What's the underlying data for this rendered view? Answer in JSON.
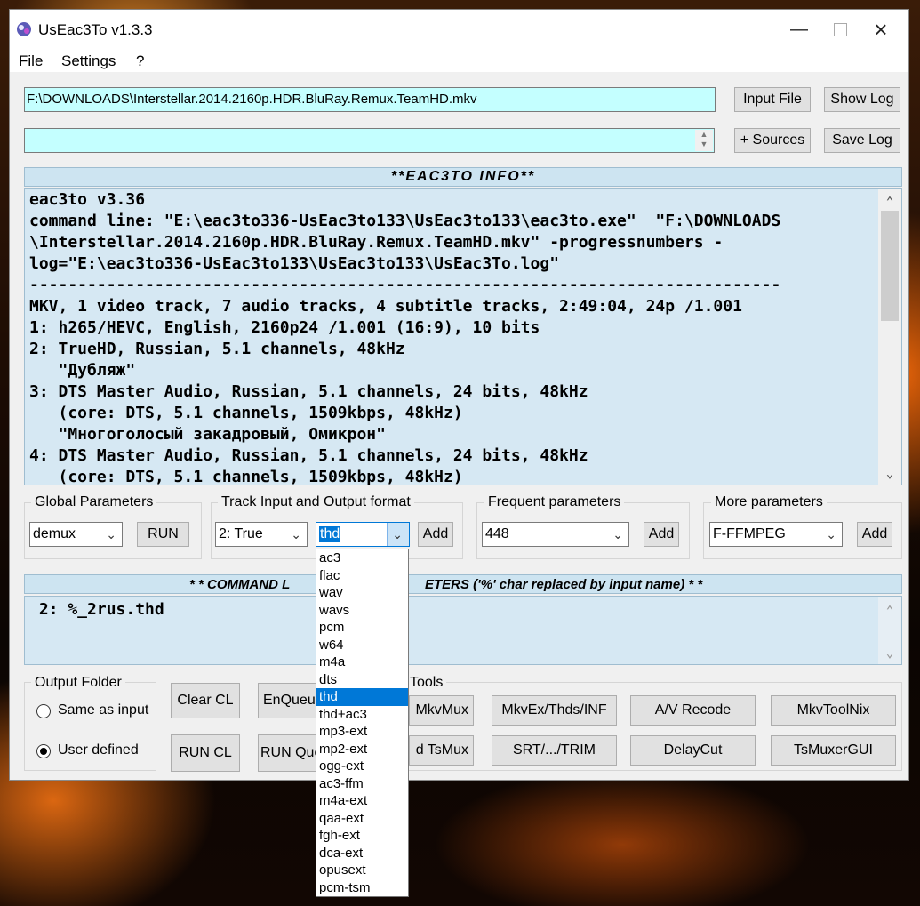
{
  "window": {
    "title": "UsEac3To v1.3.3"
  },
  "menu": [
    "File",
    "Settings",
    "?"
  ],
  "input_file_path": "F:\\DOWNLOADS\\Interstellar.2014.2160p.HDR.BluRay.Remux.TeamHD.mkv",
  "sources_value": "",
  "buttons": {
    "input_file": "Input File",
    "show_log": "Show Log",
    "sources": "+ Sources",
    "save_log": "Save Log",
    "run": "RUN",
    "add": "Add",
    "clear_cl": "Clear CL",
    "run_cl": "RUN CL",
    "enqueue": "EnQueue",
    "run_queue": "RUN Que",
    "mkvmux": "MkvMux",
    "tsmux": "d TsMux",
    "mkvex": "MkvEx/Thds/INF",
    "srt_trim": "SRT/.../TRIM",
    "av_recode": "A/V Recode",
    "delaycut": "DelayCut",
    "mkvtoolnix": "MkvToolNix",
    "tsmuxergui": "TsMuxerGUI"
  },
  "info_header": "**EAC3TO INFO**",
  "info_lines": [
    "eac3to v3.36",
    "command line: \"E:\\eac3to336-UsEac3to133\\UsEac3to133\\eac3to.exe\"  \"F:\\DOWNLOADS",
    "\\Interstellar.2014.2160p.HDR.BluRay.Remux.TeamHD.mkv\" -progressnumbers -",
    "log=\"E:\\eac3to336-UsEac3to133\\UsEac3to133\\UsEac3To.log\"",
    "------------------------------------------------------------------------------",
    "MKV, 1 video track, 7 audio tracks, 4 subtitle tracks, 2:49:04, 24p /1.001",
    "1: h265/HEVC, English, 2160p24 /1.001 (16:9), 10 bits",
    "2: TrueHD, Russian, 5.1 channels, 48kHz",
    "   \"Дубляж\"",
    "3: DTS Master Audio, Russian, 5.1 channels, 24 bits, 48kHz",
    "   (core: DTS, 5.1 channels, 1509kbps, 48kHz)",
    "   \"Многоголосый закадровый, Омикрон\"",
    "4: DTS Master Audio, Russian, 5.1 channels, 24 bits, 48kHz",
    "   (core: DTS, 5.1 channels, 1509kbps, 48kHz)"
  ],
  "groups": {
    "global": {
      "title": "Global Parameters",
      "value": "demux"
    },
    "track": {
      "title": "Track Input and Output format",
      "track_value": "2: True",
      "format_value": "thd"
    },
    "frequent": {
      "title": "Frequent parameters",
      "value": "448"
    },
    "more": {
      "title": "More parameters",
      "value": "F-FFMPEG"
    },
    "output_folder": {
      "title": "Output Folder",
      "same_as_input": "Same as input",
      "user_defined": "User defined"
    },
    "tools": {
      "title": "Tools"
    }
  },
  "cmd_header_left": "* * COMMAND L",
  "cmd_header_right": "ETERS ('%' char replaced by input name) * *",
  "cmd_text": " 2: %_2rus.thd",
  "format_options": [
    "ac3",
    "flac",
    "wav",
    "wavs",
    "pcm",
    "w64",
    "m4a",
    "dts",
    "thd",
    "thd+ac3",
    "mp3-ext",
    "mp2-ext",
    "ogg-ext",
    "ac3-ffm",
    "m4a-ext",
    "qaa-ext",
    "fgh-ext",
    "dca-ext",
    "opusext",
    "pcm-tsm"
  ],
  "format_selected_index": 8,
  "output_folder_selected": "user_defined"
}
